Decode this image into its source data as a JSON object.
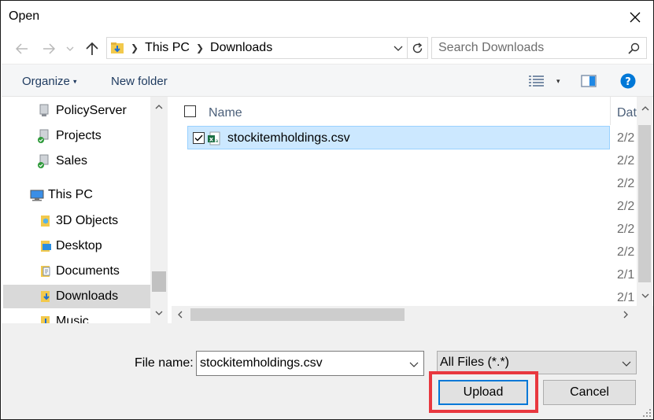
{
  "window": {
    "title": "Open"
  },
  "address_bar": {
    "segments": [
      "This PC",
      "Downloads"
    ]
  },
  "search": {
    "placeholder": "Search Downloads"
  },
  "toolbar": {
    "organize_label": "Organize",
    "new_folder_label": "New folder"
  },
  "nav_pane": {
    "items": [
      {
        "label": "PolicyServer",
        "icon": "network-folder-icon"
      },
      {
        "label": "Projects",
        "icon": "network-folder-icon"
      },
      {
        "label": "Sales",
        "icon": "network-folder-icon"
      },
      {
        "label": "This PC",
        "icon": "computer-icon"
      },
      {
        "label": "3D Objects",
        "icon": "3d-objects-folder-icon"
      },
      {
        "label": "Desktop",
        "icon": "desktop-folder-icon"
      },
      {
        "label": "Documents",
        "icon": "documents-folder-icon"
      },
      {
        "label": "Downloads",
        "icon": "downloads-folder-icon",
        "selected": true
      },
      {
        "label": "Music",
        "icon": "music-folder-icon"
      }
    ]
  },
  "file_list": {
    "columns": {
      "name": "Name",
      "date": "Dat"
    },
    "files": [
      {
        "name": "stockitemholdings.csv",
        "selected": true,
        "icon": "excel-csv-icon"
      }
    ],
    "date_column_values": [
      "2/2",
      "2/2",
      "2/2",
      "2/2",
      "2/2",
      "2/2",
      "2/1",
      "2/1"
    ]
  },
  "bottom": {
    "file_name_label": "File name:",
    "file_name_value": "stockitemholdings.csv",
    "file_type_value": "All Files (*.*)",
    "upload_label": "Upload",
    "cancel_label": "Cancel"
  },
  "colors": {
    "selection_bg": "#cce8ff",
    "highlight_border": "#e8383f",
    "help_blue": "#0078d7"
  }
}
